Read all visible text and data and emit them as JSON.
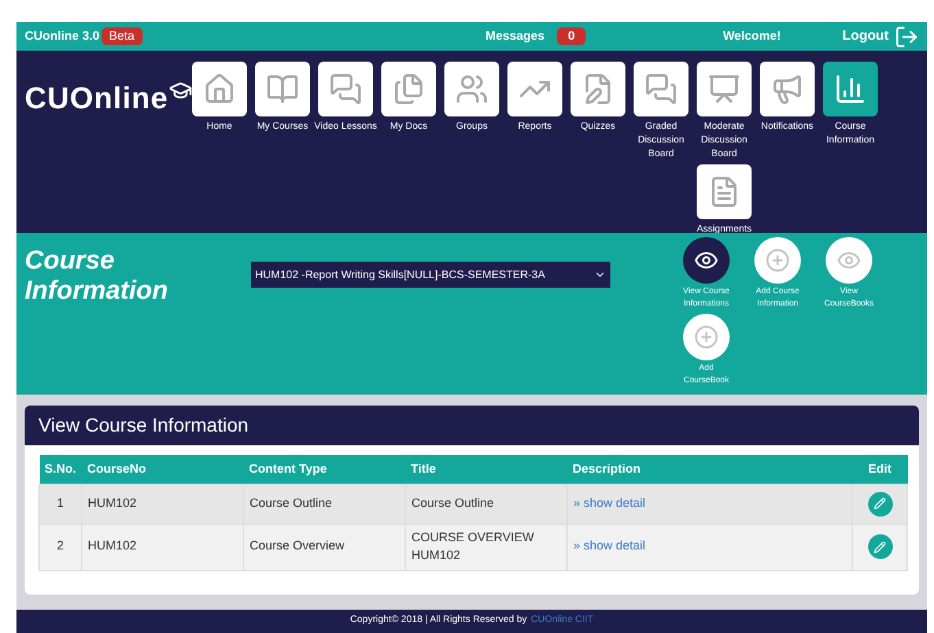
{
  "top_bar": {
    "app_name": "CUonline 3.0",
    "badge": "Beta",
    "messages_label": "Messages",
    "messages_count": "0",
    "welcome": "Welcome!",
    "logout": "Logout"
  },
  "logo": "CUOnline",
  "nav": [
    {
      "label": "Home",
      "selected": false
    },
    {
      "label": "My Courses",
      "selected": false
    },
    {
      "label": "Video Lessons",
      "selected": false
    },
    {
      "label": "My Docs",
      "selected": false
    },
    {
      "label": "Groups",
      "selected": false
    },
    {
      "label": "Reports",
      "selected": false
    },
    {
      "label": "Quizzes",
      "selected": false
    },
    {
      "label": "Graded Discussion Board",
      "selected": false
    },
    {
      "label": "Moderate Discussion Board",
      "selected": false
    },
    {
      "label": "Notifications",
      "selected": false
    },
    {
      "label": "Course Information",
      "selected": true
    },
    {
      "label": "Assignments",
      "selected": false
    }
  ],
  "section": {
    "title": "Course Information",
    "course_select": "HUM102 -Report Writing Skills[NULL]-BCS-SEMESTER-3A",
    "actions": [
      {
        "label": "View Course Informations",
        "kind": "view",
        "selected": true
      },
      {
        "label": "Add Course Information",
        "kind": "add",
        "selected": false
      },
      {
        "label": "View CourseBooks",
        "kind": "view",
        "selected": false
      },
      {
        "label": "Add CourseBook",
        "kind": "add",
        "selected": false
      }
    ]
  },
  "panel": {
    "title": "View Course Information",
    "columns": [
      "S.No.",
      "CourseNo",
      "Content Type",
      "Title",
      "Description",
      "Edit"
    ],
    "rows": [
      {
        "sno": "1",
        "course_no": "HUM102",
        "content_type": "Course Outline",
        "title": "Course Outline",
        "description": "» show detail"
      },
      {
        "sno": "2",
        "course_no": "HUM102",
        "content_type": "Course Overview",
        "title": "COURSE OVERVIEW HUM102",
        "description": "» show detail"
      }
    ]
  },
  "footer": {
    "text": "Copyright© 2018 | All Rights Reserved by",
    "link": "CUOnline CIIT"
  }
}
